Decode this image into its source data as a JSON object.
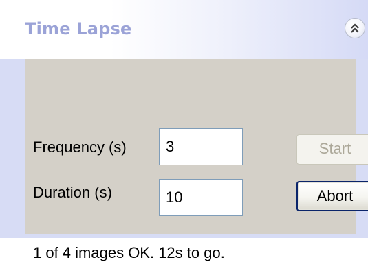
{
  "panel": {
    "title": "Time Lapse",
    "collapse_icon": "double-chevron-up-icon"
  },
  "form": {
    "frequency_label": "Frequency (s)",
    "frequency_value": "3",
    "duration_label": "Duration (s)",
    "duration_value": "10",
    "start_label": "Start",
    "start_enabled": false,
    "abort_label": "Abort"
  },
  "status": {
    "text": "1 of 4 images OK. 12s to go."
  },
  "colors": {
    "title": "#9ba3d7",
    "content_background": "#d4d0c8",
    "panel_background": "#d7dcf5",
    "disabled_text": "#aca899",
    "default_button_border": "#0a246a"
  }
}
